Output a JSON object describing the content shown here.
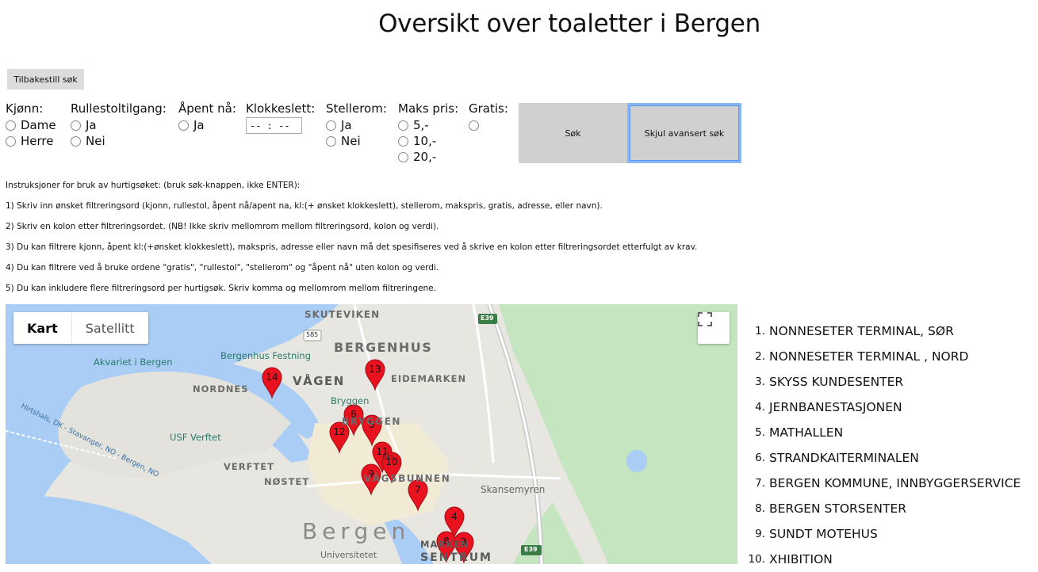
{
  "page_title": "Oversikt over toaletter i Bergen",
  "reset_label": "Tilbakestill søk",
  "filters": {
    "gender": {
      "label": "Kjønn:",
      "options": [
        "Dame",
        "Herre"
      ]
    },
    "wheelchair": {
      "label": "Rullestoltilgang:",
      "options": [
        "Ja",
        "Nei"
      ]
    },
    "open_now": {
      "label": "Åpent nå:",
      "options": [
        "Ja"
      ]
    },
    "time": {
      "label": "Klokkeslett:",
      "value": "-- : --"
    },
    "changing_room": {
      "label": "Stellerom:",
      "options": [
        "Ja",
        "Nei"
      ]
    },
    "max_price": {
      "label": "Maks pris:",
      "options": [
        "5,-",
        "10,-",
        "20,-"
      ]
    },
    "free": {
      "label": "Gratis:"
    }
  },
  "search_label": "Søk",
  "hide_advanced_label": "Skjul avansert søk",
  "instructions": [
    "Instruksjoner for bruk av hurtigsøket: (bruk søk-knappen, ikke ENTER):",
    "1) Skriv inn ønsket filtreringsord (kjonn, rullestol, åpent nå/apent na, kl:(+ ønsket klokkeslett), stellerom, makspris, gratis, adresse, eller navn).",
    "2) Skriv en kolon etter filtreringsordet. (NB! Ikke skriv mellomrom mellom filtreringsord, kolon og verdi).",
    "3) Du kan filtrere kjonn, åpent kl:(+ønsket klokkeslett), makspris, adresse eller navn må det spesifiseres ved å skrive en kolon etter filtreringsordet etterfulgt av krav.",
    "4) Du kan filtrere ved å bruke ordene \"gratis\", \"rullestol\", \"stellerom\" og \"åpent nå\" uten kolon og verdi.",
    "5) Du kan inkludere flere filtreringsord per hurtigsøk. Skriv komma og mellomrom mellom filtreringene."
  ],
  "map": {
    "type_map": "Kart",
    "type_satellite": "Satellitt",
    "labels": {
      "skuteviken": "SKUTEVIKEN",
      "bergenhus": "BERGENHUS",
      "festning": "Bergenhus Festning",
      "akvariet": "Akvariet i Bergen",
      "nordnes": "NORDNES",
      "vagen": "VÅGEN",
      "eidemarken": "EIDEMARKEN",
      "bryggen_place": "Bryggen",
      "bryggen": "BRYGGEN",
      "usf": "USF Verftet",
      "verftet": "VERFTET",
      "nostet": "NØSTET",
      "vaagsbunnen": "VÅGSBUNNEN",
      "skansemyren": "Skansemyren",
      "bergen": "Bergen",
      "universitetet": "Universitetet",
      "marken": "MARKEN",
      "sentrum": "SENTRUM",
      "ferry": "Hirtshals, DK - Stavanger, NO - Bergen, NO",
      "road585": "585",
      "e39": "E39"
    },
    "markers": [
      "14",
      "13",
      "6",
      "12",
      "5",
      "11",
      "10",
      "9",
      "7",
      "4",
      "8",
      "3"
    ]
  },
  "results": [
    "NONNESETER TERMINAL, SØR",
    "NONNESETER TERMINAL , NORD",
    "SKYSS KUNDESENTER",
    "JERNBANESTASJONEN",
    "MATHALLEN",
    "STRANDKAITERMINALEN",
    "BERGEN KOMMUNE, INNBYGGERSERVICE",
    "BERGEN STORSENTER",
    "SUNDT MOTEHUS",
    "XHIBITION"
  ],
  "colors": {
    "marker": "#e8131f",
    "water": "#a9cdf5",
    "park": "#c4e5bf",
    "button": "#d0d0d0"
  }
}
